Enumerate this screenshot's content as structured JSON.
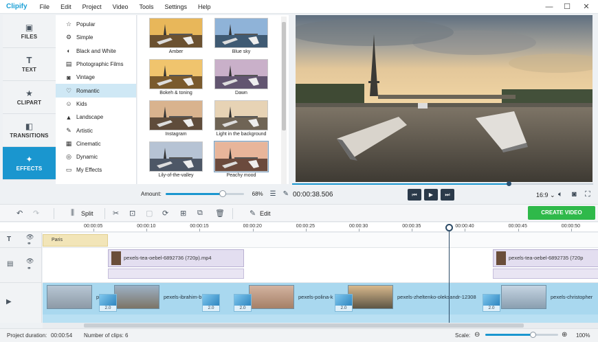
{
  "app": {
    "name": "Clipify"
  },
  "menu": [
    "File",
    "Edit",
    "Project",
    "Video",
    "Tools",
    "Settings",
    "Help"
  ],
  "window_controls": {
    "minimize": "—",
    "maximize": "☐",
    "close": "✕"
  },
  "tabs": [
    {
      "label": "FILES",
      "icon": "image-icon"
    },
    {
      "label": "TEXT",
      "icon": "text-t-icon"
    },
    {
      "label": "CLIPART",
      "icon": "star-icon"
    },
    {
      "label": "TRANSITIONS",
      "icon": "transitions-icon"
    },
    {
      "label": "EFFECTS",
      "icon": "magic-wand-icon",
      "active": true
    }
  ],
  "categories": [
    {
      "label": "Popular",
      "icon": "star-icon"
    },
    {
      "label": "Simple",
      "icon": "gear-icon"
    },
    {
      "label": "Black and White",
      "icon": "contrast-icon"
    },
    {
      "label": "Photographic Films",
      "icon": "film-icon"
    },
    {
      "label": "Vintage",
      "icon": "camera-icon"
    },
    {
      "label": "Romantic",
      "icon": "heart-icon",
      "active": true
    },
    {
      "label": "Kids",
      "icon": "kids-icon"
    },
    {
      "label": "Landscape",
      "icon": "mountain-icon"
    },
    {
      "label": "Artistic",
      "icon": "brush-icon"
    },
    {
      "label": "Cinematic",
      "icon": "clapper-icon"
    },
    {
      "label": "Dynamic",
      "icon": "dynamic-icon"
    },
    {
      "label": "My Effects",
      "icon": "folder-icon"
    }
  ],
  "presets": [
    {
      "name": "Amber",
      "sky": "#e8b75a",
      "water": "#6b5130"
    },
    {
      "name": "Blue sky",
      "sky": "#8fb3d8",
      "water": "#3f5a73"
    },
    {
      "name": "Bokeh & toning",
      "sky": "#f0c46d",
      "water": "#7a5a2d"
    },
    {
      "name": "Dawn",
      "sky": "#c9b0c9",
      "water": "#625570"
    },
    {
      "name": "Instagram",
      "sky": "#d9b38e",
      "water": "#5f4c3b"
    },
    {
      "name": "Light in the background",
      "sky": "#e7d3b5",
      "water": "#6f6455"
    },
    {
      "name": "Lily-of-the-valley",
      "sky": "#b6c3d4",
      "water": "#4d5766"
    },
    {
      "name": "Peachy mood",
      "sky": "#e8b59a",
      "water": "#6b4a3d",
      "selected": true
    }
  ],
  "amount": {
    "label": "Amount:",
    "value_text": "68%",
    "value": 0.68
  },
  "player": {
    "timecode": "00:00:38.506",
    "progress": 0.72,
    "ratio": "16:9 ⌄",
    "controls": {
      "prev": "⏮",
      "play": "▶",
      "next": "⏭"
    }
  },
  "toolbar": {
    "split_label": "Split",
    "edit_label": "Edit",
    "create_label": "CREATE VIDEO"
  },
  "ruler": [
    "00:00:05",
    "00:00:10",
    "00:00:15",
    "00:00:20",
    "00:00:25",
    "00:00:30",
    "00:00:35",
    "00:00:40",
    "00:00:45",
    "00:00:50"
  ],
  "timeline": {
    "text_clip": "Paris",
    "video_clips": [
      "pexels-tea-oebel-6892736 (720p).mp4",
      "pexels-tea-oebel-6892735 (720p"
    ],
    "main_clips": [
      "pexels-ibrahim-b",
      "pexels-polina-k",
      "pexels-zheltenko-oleksandr-12308",
      "pexels-christopher"
    ],
    "transition_label": "2.0"
  },
  "status": {
    "duration_label": "Project duration:",
    "duration": "00:00:54",
    "clips_label": "Number of clips:",
    "clips": "6",
    "scale_label": "Scale:",
    "scale": "100%",
    "scale_value": 0.65
  },
  "colors": {
    "accent": "#1a96cf",
    "create": "#2fb94a"
  }
}
